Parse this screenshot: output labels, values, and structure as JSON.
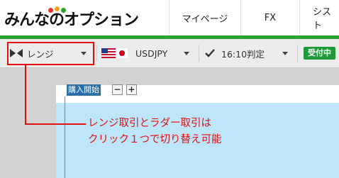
{
  "header": {
    "logo_text": "みんなのオプション",
    "nav": [
      {
        "label": "マイページ"
      },
      {
        "label": "FX"
      },
      {
        "label": "シスト"
      }
    ]
  },
  "toolbar": {
    "mode_label": "レンジ",
    "pair_label": "USDJPY",
    "time_label": "16:10判定",
    "status_label": "受付中"
  },
  "chart": {
    "buy_start_label": "購入開始",
    "zoom_out_label": "−",
    "zoom_in_label": "+"
  },
  "annotation": {
    "line1": "レンジ取引とラダー取引は",
    "line2": "クリック１つで切り替え可能"
  },
  "colors": {
    "brand_green": "#2aa232",
    "status_green": "#1f9a3a",
    "annotation_red": "#e01010",
    "chart_blue": "#bde6fb",
    "label_blue": "#2a6fa8"
  },
  "icons": [
    "play-pause-icon",
    "us-flag-icon",
    "japan-flag-icon",
    "checkmark-icon",
    "caret-down-icon"
  ]
}
